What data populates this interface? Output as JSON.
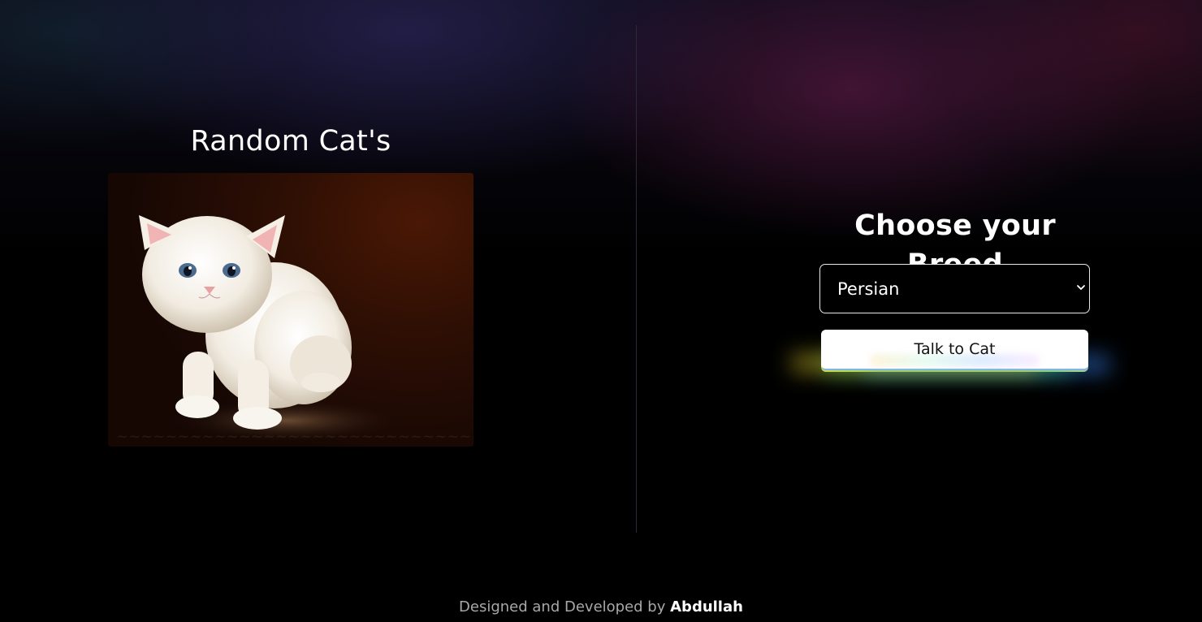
{
  "left_panel": {
    "title": "Random Cat's",
    "image": "white-kitten-photo"
  },
  "right_panel": {
    "title": "Choose your Breed",
    "breed_select": {
      "selected": "Persian"
    },
    "talk_button_label": "Talk to Cat"
  },
  "footer": {
    "prefix": "Designed and Developed by",
    "author": "Abdullah"
  },
  "colors": {
    "background": "#000000",
    "text_primary": "#ffffff",
    "footer_text": "#a8a8a8"
  }
}
